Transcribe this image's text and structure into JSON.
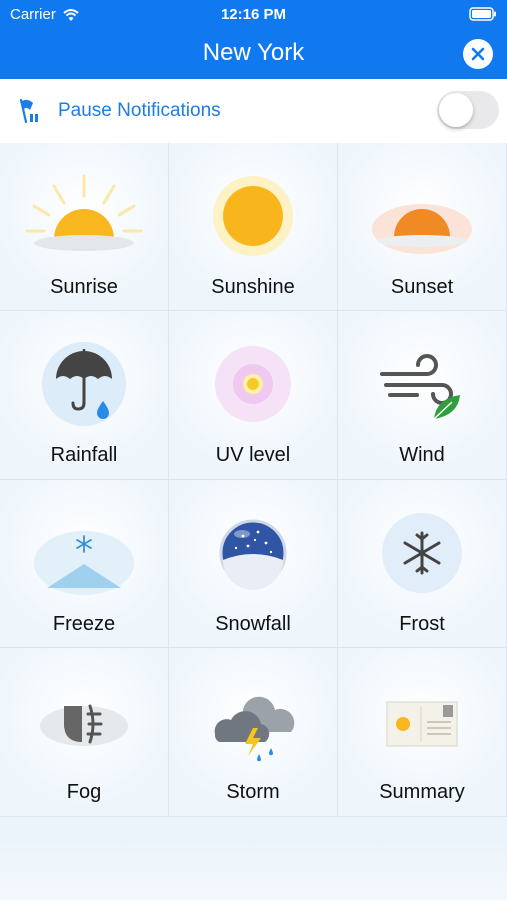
{
  "status_bar": {
    "carrier": "Carrier",
    "time": "12:16 PM"
  },
  "nav": {
    "title": "New York"
  },
  "pause": {
    "label": "Pause Notifications",
    "enabled": false
  },
  "tiles": [
    {
      "label": "Sunrise",
      "icon": "sunrise-icon"
    },
    {
      "label": "Sunshine",
      "icon": "sun-icon"
    },
    {
      "label": "Sunset",
      "icon": "sunset-icon"
    },
    {
      "label": "Rainfall",
      "icon": "umbrella-icon"
    },
    {
      "label": "UV level",
      "icon": "uv-icon"
    },
    {
      "label": "Wind",
      "icon": "wind-icon"
    },
    {
      "label": "Freeze",
      "icon": "freeze-icon"
    },
    {
      "label": "Snowfall",
      "icon": "snow-globe-icon"
    },
    {
      "label": "Frost",
      "icon": "snowflake-icon"
    },
    {
      "label": "Fog",
      "icon": "fog-light-icon"
    },
    {
      "label": "Storm",
      "icon": "storm-cloud-icon"
    },
    {
      "label": "Summary",
      "icon": "postcard-icon"
    }
  ],
  "colors": {
    "accent": "#1179f0",
    "link": "#1a7ee6"
  }
}
